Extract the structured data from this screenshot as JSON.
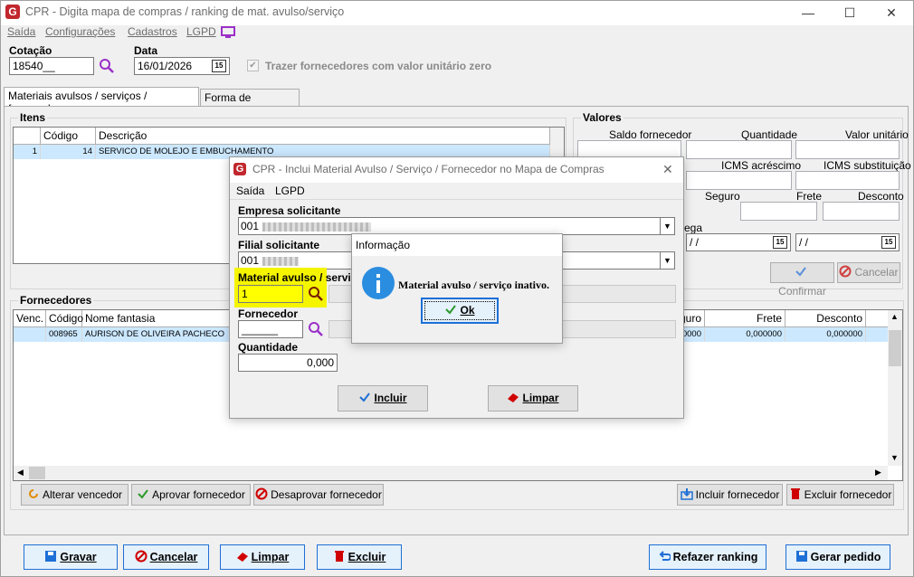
{
  "window": {
    "title": "CPR - Digita mapa de compras / ranking de mat. avulso/serviço",
    "app_icon": "G",
    "minimize": "—",
    "maximize": "☐",
    "close": "✕"
  },
  "menu": [
    "Saída",
    "Configurações",
    "Cadastros",
    "LGPD"
  ],
  "header": {
    "cotacao_label": "Cotação",
    "cotacao_value": "18540__",
    "data_label": "Data",
    "data_value": "16/01/2026",
    "cal_icon": "15",
    "trazer_label": "Trazer fornecedores com valor unitário zero"
  },
  "tabs": [
    "Materiais avulsos / serviços / fornecedores",
    "Forma de pagamento"
  ],
  "itens": {
    "title": "Itens",
    "columns": [
      "Código",
      "Descrição"
    ],
    "row": {
      "seq": "1",
      "codigo": "14",
      "descricao": "SERVICO DE MOLEJO E EMBUCHAMENTO"
    }
  },
  "valores": {
    "title": "Valores",
    "labels": [
      "Saldo fornecedor",
      "Quantidade",
      "Valor unitário",
      "ICMS acréscimo",
      "ICMS substituição",
      "Seguro",
      "Frete",
      "Desconto"
    ],
    "entrega_label_fragment": "ega",
    "date1": " /  /",
    "date2": " /  /",
    "confirmar": "Confirmar",
    "cancelar": "Cancelar"
  },
  "fornecedores": {
    "title": "Fornecedores",
    "columns": [
      "Venc.",
      "Código",
      "Nome fantasia",
      "guro",
      "Frete",
      "Desconto"
    ],
    "row": {
      "codigo": "008965",
      "nome": "AURISON DE OLIVEIRA PACHECO",
      "seguro": "0000",
      "frete": "0,000000",
      "desconto": "0,000000"
    },
    "buttons": [
      "Alterar vencedor",
      "Aprovar fornecedor",
      "Desaprovar fornecedor",
      "Incluir fornecedor",
      "Excluir fornecedor"
    ]
  },
  "bottom_buttons": [
    "Gravar",
    "Cancelar",
    "Limpar",
    "Excluir",
    "Refazer ranking",
    "Gerar pedido"
  ],
  "dialog": {
    "title": "CPR - Inclui Material Avulso / Serviço / Fornecedor no Mapa de Compras",
    "menu": [
      "Saída",
      "LGPD"
    ],
    "empresa_label": "Empresa solicitante",
    "empresa_value": "001",
    "filial_label": "Filial solicitante",
    "filial_value": "001",
    "material_label": "Material avulso / servi",
    "material_value": "1",
    "fornecedor_label": "Fornecedor",
    "fornecedor_value": "______",
    "quantidade_label": "Quantidade",
    "quantidade_value": "0,000",
    "incluir": "Incluir",
    "limpar": "Limpar"
  },
  "info": {
    "title": "Informação",
    "message": "Material avulso / serviço inativo.",
    "ok": "Ok"
  }
}
